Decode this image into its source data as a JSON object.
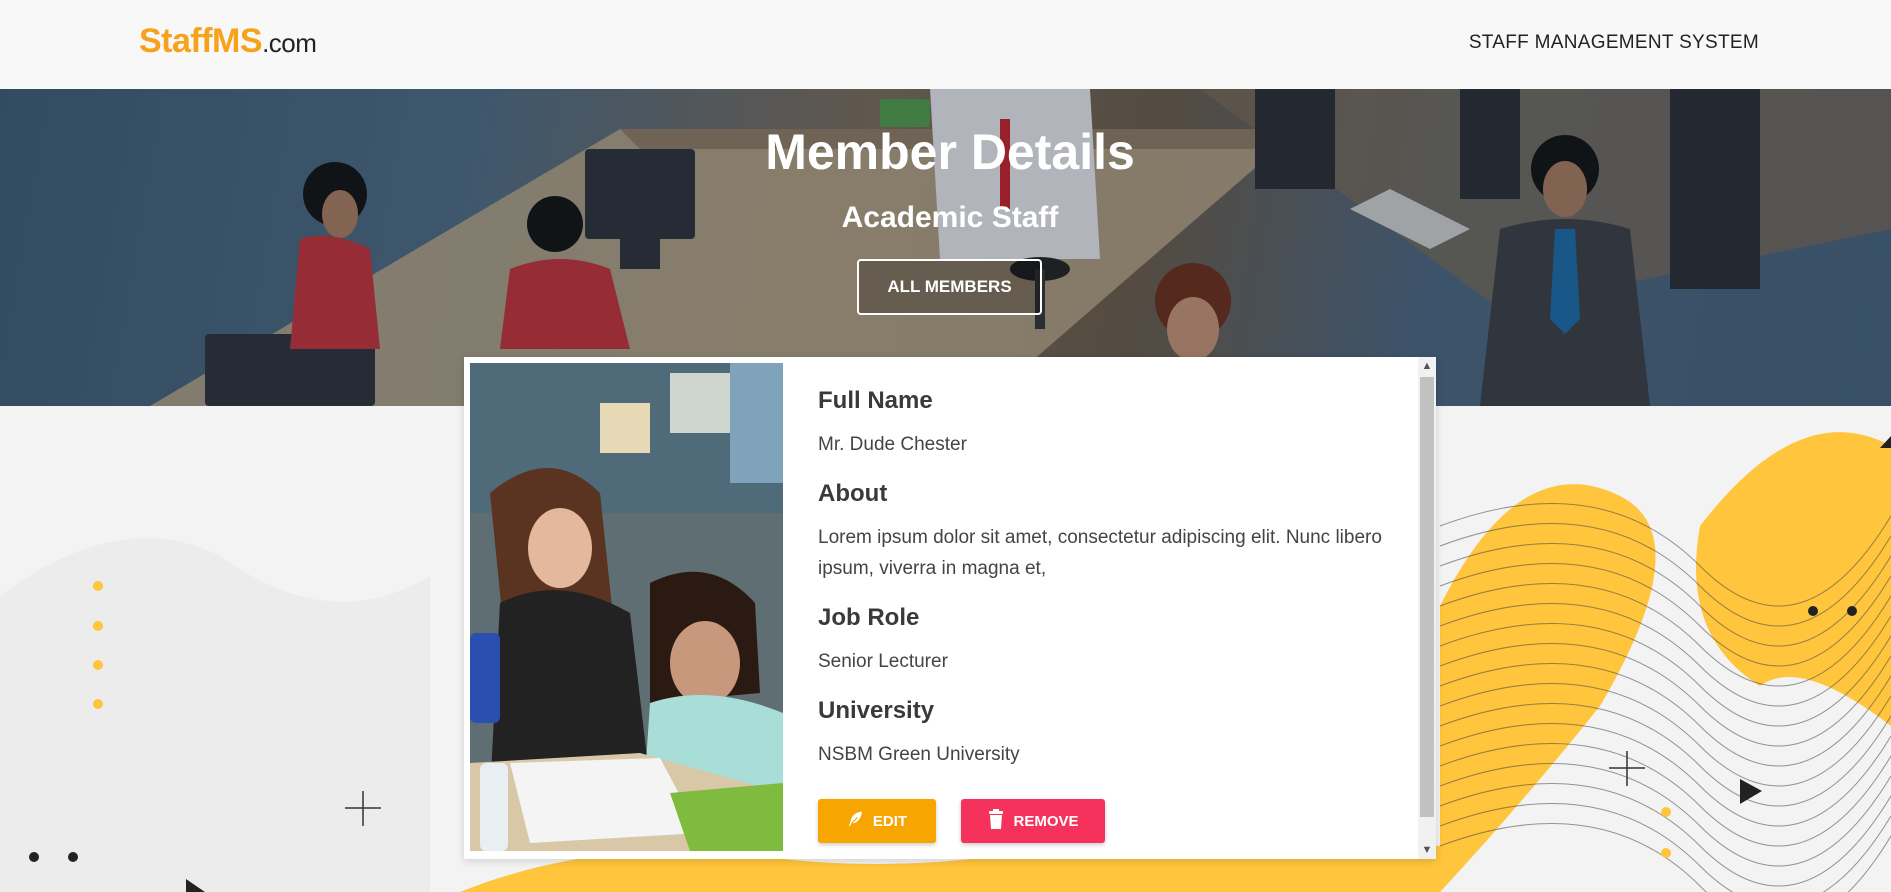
{
  "header": {
    "brand_main": "StaffMS",
    "brand_suffix": ".com",
    "nav_title": "STAFF MANAGEMENT SYSTEM"
  },
  "hero": {
    "title": "Member Details",
    "subtitle": "Academic Staff",
    "button_label": "ALL MEMBERS"
  },
  "member": {
    "fields": [
      {
        "label": "Full Name",
        "value": "Mr. Dude Chester"
      },
      {
        "label": "About",
        "value": "Lorem ipsum dolor sit amet, consectetur adipiscing elit. Nunc libero ipsum, viverra in magna et,"
      },
      {
        "label": "Job Role",
        "value": "Senior Lecturer"
      },
      {
        "label": "University",
        "value": "NSBM Green University"
      }
    ],
    "edit_label": "EDIT",
    "remove_label": "REMOVE"
  },
  "colors": {
    "brand": "#f8a11b",
    "edit": "#f7a500",
    "remove": "#f5325c"
  },
  "icons": {
    "edit": "feather-icon",
    "remove": "trash-icon"
  }
}
